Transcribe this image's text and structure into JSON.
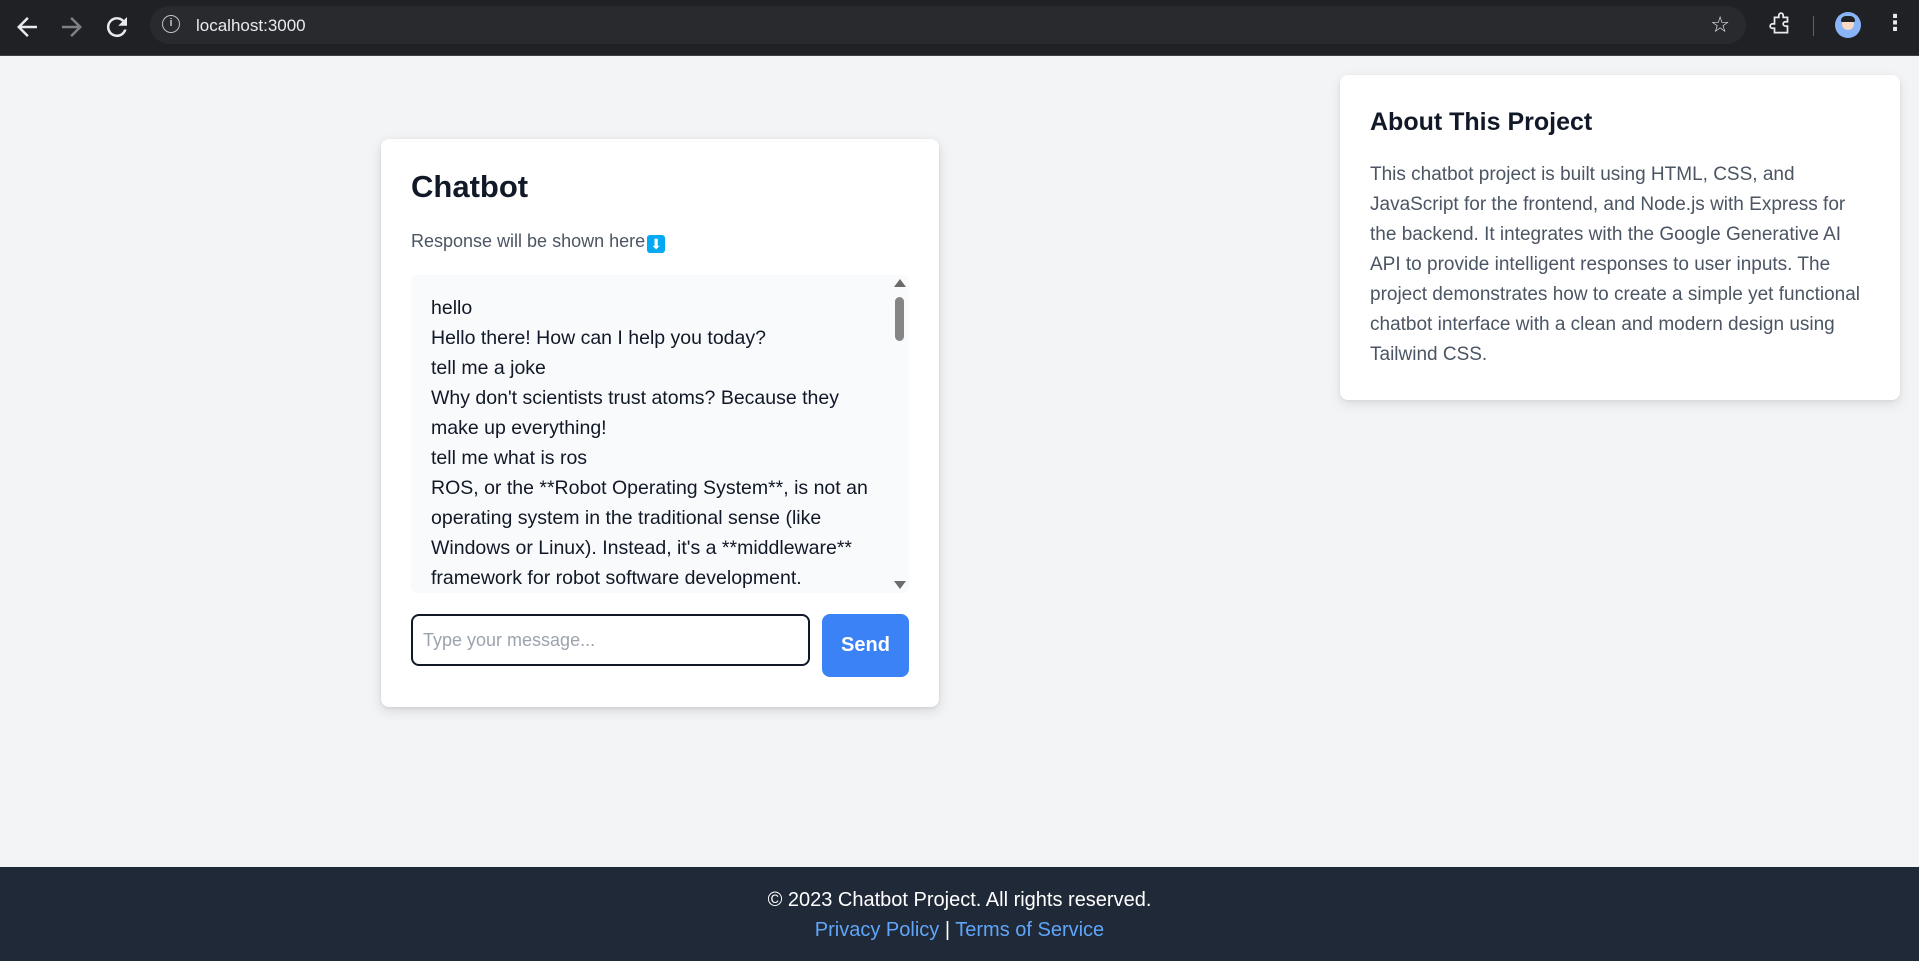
{
  "browser": {
    "url": "localhost:3000",
    "icons": [
      "back-icon",
      "forward-icon",
      "reload-icon",
      "site-info-icon",
      "bookmark-star-icon",
      "extensions-icon",
      "profile-avatar",
      "menu-icon"
    ]
  },
  "chat": {
    "title": "Chatbot",
    "response_label": "Response will be shown here",
    "response_icon": "⬇",
    "messages": [
      "hello",
      "Hello there! How can I help you today?",
      "tell me a joke",
      "Why don't scientists trust atoms? Because they make up everything!",
      "tell me what is ros",
      "ROS, or the **Robot Operating System**, is not an operating system in the traditional sense (like Windows or Linux). Instead, it's a **middleware** framework for robot software development."
    ],
    "input_placeholder": "Type your message...",
    "input_value": "",
    "send_label": "Send",
    "accent_color": "#3b82f6"
  },
  "about": {
    "title": "About This Project",
    "text": "This chatbot project is built using HTML, CSS, and JavaScript for the frontend, and Node.js with Express for the backend. It integrates with the Google Generative AI API to provide intelligent responses to user inputs. The project demonstrates how to create a simple yet functional chatbot interface with a clean and modern design using Tailwind CSS."
  },
  "footer": {
    "copyright": "© 2023 Chatbot Project. All rights reserved.",
    "privacy_label": "Privacy Policy",
    "separator": "|",
    "terms_label": "Terms of Service"
  }
}
